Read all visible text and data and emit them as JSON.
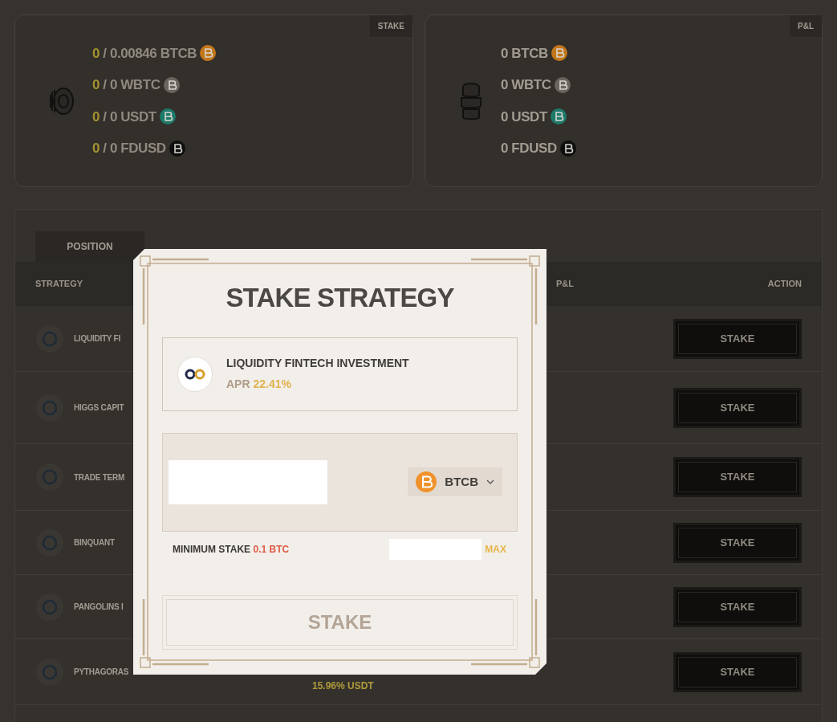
{
  "stake_card": {
    "badge": "STAKE",
    "rows": [
      {
        "staked": "0",
        "total": " / 0.00846 BTCB",
        "color": "#c2761a"
      },
      {
        "staked": "0",
        "total": " / 0 WBTC",
        "color": "#6a665f"
      },
      {
        "staked": "0",
        "total": " / 0 USDT",
        "color": "#1c7a6b"
      },
      {
        "staked": "0",
        "total": " / 0 FDUSD",
        "color": "#0e0e0e"
      }
    ]
  },
  "pnl_card": {
    "badge": "P&L",
    "rows": [
      {
        "text": "0 BTCB",
        "color": "#c2761a"
      },
      {
        "text": "0 WBTC",
        "color": "#6a665f"
      },
      {
        "text": "0 USDT",
        "color": "#1c7a6b"
      },
      {
        "text": "0 FDUSD",
        "color": "#0e0e0e"
      }
    ]
  },
  "positions": {
    "tabs": [
      {
        "label": "POSITION",
        "selected": true
      }
    ],
    "columns": [
      "STRATEGY",
      "P&L",
      "ACTION"
    ],
    "rows": [
      {
        "name": "LIQUIDITY FI",
        "action": "STAKE"
      },
      {
        "name": "HIGGS CAPIT",
        "action": "STAKE"
      },
      {
        "name": "TRADE TERM",
        "action": "STAKE"
      },
      {
        "name": "BINQUANT",
        "action": "STAKE"
      },
      {
        "name": "PANGOLINS I",
        "action": "STAKE"
      },
      {
        "name": "PYTHAGORAS",
        "apr": "15.96% USDT",
        "action": "STAKE"
      }
    ]
  },
  "modal": {
    "title": "STAKE STRATEGY",
    "strategy": {
      "name": "LIQUIDITY FINTECH INVESTMENT",
      "apr_label": "APR",
      "apr": "22.41%"
    },
    "token_select": {
      "color": "#f0922b",
      "label": "BTCB"
    },
    "minimum_label": "MINIMUM STAKE",
    "minimum_value": "0.1 BTC",
    "max": "MAX",
    "submit": {
      "label": "STAKE",
      "disabled": true
    }
  }
}
